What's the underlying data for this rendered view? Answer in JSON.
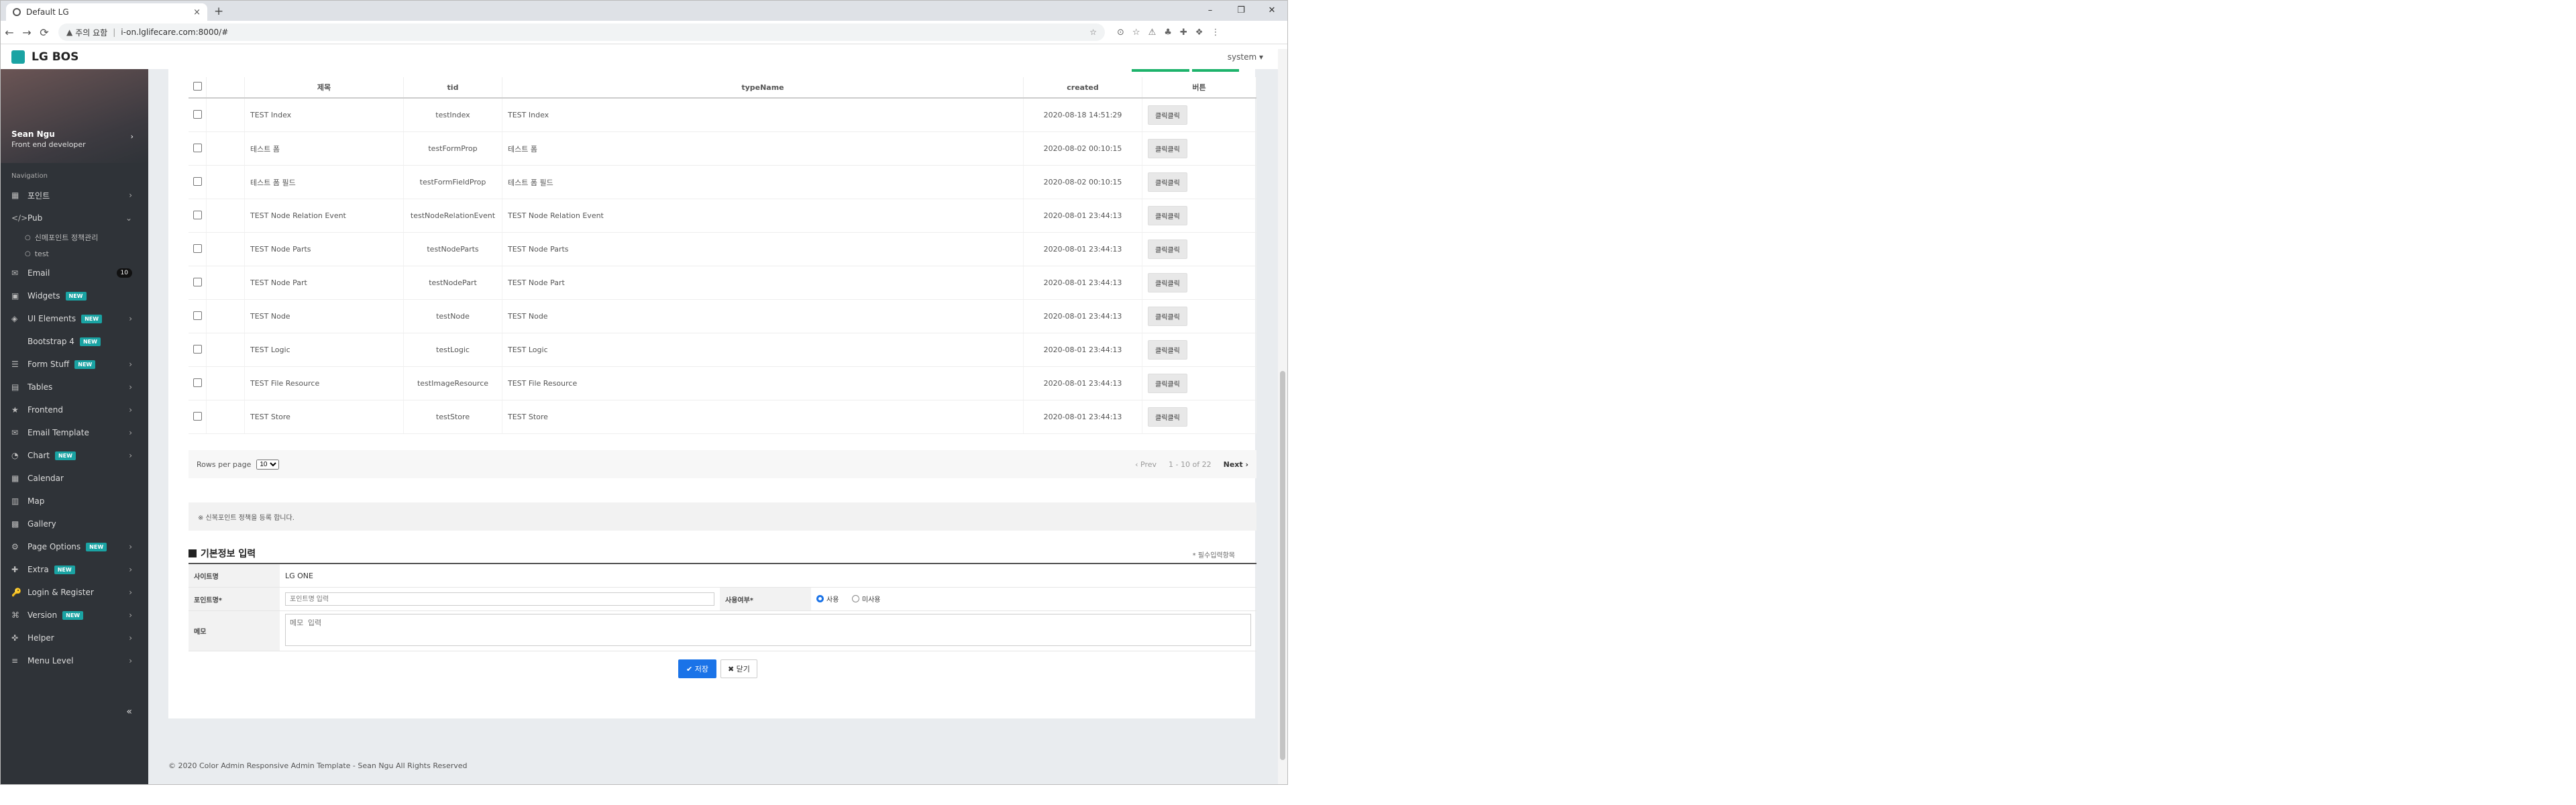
{
  "browser": {
    "tab_title": "Default LG",
    "tab_close": "×",
    "new_tab": "+",
    "win_min": "–",
    "win_max": "❐",
    "win_close": "✕",
    "back": "←",
    "forward": "→",
    "reload": "⟳",
    "security_icon": "▲",
    "security_label": "주의 요함",
    "url": "i-on.lglifecare.com:8000/#",
    "bookmark_icon": "☆",
    "ext_icons": [
      "⊙",
      "☆",
      "⚠",
      "♣",
      "✚",
      "❖",
      "⋮"
    ]
  },
  "app": {
    "logo": "LG BOS",
    "user_menu": "system ▾"
  },
  "sidebar": {
    "profile_name": "Sean Ngu",
    "profile_role": "Front end developer",
    "profile_chev": "›",
    "nav_label": "Navigation",
    "items": [
      {
        "icon": "▦",
        "label": "포인트",
        "chev": "›",
        "badge": ""
      },
      {
        "icon": "</>",
        "label": "Pub",
        "chev": "⌄",
        "badge": ""
      },
      {
        "icon": "✉",
        "label": "Email",
        "chev": "",
        "badge": "",
        "count": "10"
      },
      {
        "icon": "▣",
        "label": "Widgets",
        "chev": "",
        "badge": "NEW"
      },
      {
        "icon": "◈",
        "label": "UI Elements",
        "chev": "›",
        "badge": "NEW"
      },
      {
        "icon": "",
        "label": "Bootstrap 4",
        "chev": "",
        "badge": "NEW"
      },
      {
        "icon": "☰",
        "label": "Form Stuff",
        "chev": "›",
        "badge": "NEW"
      },
      {
        "icon": "▤",
        "label": "Tables",
        "chev": "›",
        "badge": ""
      },
      {
        "icon": "★",
        "label": "Frontend",
        "chev": "›",
        "badge": ""
      },
      {
        "icon": "✉",
        "label": "Email Template",
        "chev": "›",
        "badge": ""
      },
      {
        "icon": "◔",
        "label": "Chart",
        "chev": "›",
        "badge": "NEW"
      },
      {
        "icon": "▦",
        "label": "Calendar",
        "chev": "",
        "badge": ""
      },
      {
        "icon": "▥",
        "label": "Map",
        "chev": "",
        "badge": ""
      },
      {
        "icon": "▩",
        "label": "Gallery",
        "chev": "",
        "badge": ""
      },
      {
        "icon": "⚙",
        "label": "Page Options",
        "chev": "›",
        "badge": "NEW"
      },
      {
        "icon": "✚",
        "label": "Extra",
        "chev": "›",
        "badge": "NEW"
      },
      {
        "icon": "🔑",
        "label": "Login & Register",
        "chev": "›",
        "badge": ""
      },
      {
        "icon": "⌘",
        "label": "Version",
        "chev": "›",
        "badge": "NEW"
      },
      {
        "icon": "✜",
        "label": "Helper",
        "chev": "›",
        "badge": ""
      },
      {
        "icon": "≡",
        "label": "Menu Level",
        "chev": "›",
        "badge": ""
      }
    ],
    "subitems": [
      "신메포인트 정책관리",
      "test"
    ],
    "collapse": "«"
  },
  "table": {
    "headers": [
      "",
      "",
      "제목",
      "tid",
      "typeName",
      "created",
      "버튼"
    ],
    "rows": [
      {
        "title": "TEST Index",
        "tid": "testIndex",
        "typeName": "TEST Index",
        "created": "2020-08-18 14:51:29",
        "btn": "클릭클릭"
      },
      {
        "title": "테스트 폼",
        "tid": "testFormProp",
        "typeName": "테스트 폼",
        "created": "2020-08-02 00:10:15",
        "btn": "클릭클릭"
      },
      {
        "title": "테스트 폼 필드",
        "tid": "testFormFieldProp",
        "typeName": "테스트 폼 필드",
        "created": "2020-08-02 00:10:15",
        "btn": "클릭클릭"
      },
      {
        "title": "TEST Node Relation Event",
        "tid": "testNodeRelationEvent",
        "typeName": "TEST Node Relation Event",
        "created": "2020-08-01 23:44:13",
        "btn": "클릭클릭"
      },
      {
        "title": "TEST Node Parts",
        "tid": "testNodeParts",
        "typeName": "TEST Node Parts",
        "created": "2020-08-01 23:44:13",
        "btn": "클릭클릭"
      },
      {
        "title": "TEST Node Part",
        "tid": "testNodePart",
        "typeName": "TEST Node Part",
        "created": "2020-08-01 23:44:13",
        "btn": "클릭클릭"
      },
      {
        "title": "TEST Node",
        "tid": "testNode",
        "typeName": "TEST Node",
        "created": "2020-08-01 23:44:13",
        "btn": "클릭클릭"
      },
      {
        "title": "TEST Logic",
        "tid": "testLogic",
        "typeName": "TEST Logic",
        "created": "2020-08-01 23:44:13",
        "btn": "클릭클릭"
      },
      {
        "title": "TEST File Resource",
        "tid": "testImageResource",
        "typeName": "TEST File Resource",
        "created": "2020-08-01 23:44:13",
        "btn": "클릭클릭"
      },
      {
        "title": "TEST Store",
        "tid": "testStore",
        "typeName": "TEST Store",
        "created": "2020-08-01 23:44:13",
        "btn": "클릭클릭"
      }
    ]
  },
  "pager": {
    "rows_per_page_label": "Rows per page",
    "rows_per_page_value": "10",
    "prev": "‹ Prev",
    "range": "1 - 10 of 22",
    "next": "Next ›"
  },
  "info": "※ 신복포인트 정책을 등록 합니다.",
  "form": {
    "title": "기본정보 입력",
    "required_note": "* 필수입력항목",
    "site_label": "사이트명",
    "site_value": "LG ONE",
    "point_label": "포인트명*",
    "point_placeholder": "포인트명 입력",
    "use_label": "사용여부*",
    "use_yes": "사용",
    "use_no": "미사용",
    "memo_label": "메모",
    "memo_placeholder": "메모 입력",
    "save": "✔ 저장",
    "close": "✖ 닫기"
  },
  "footer": "© 2020 Color Admin Responsive Admin Template - Sean Ngu All Rights Reserved"
}
